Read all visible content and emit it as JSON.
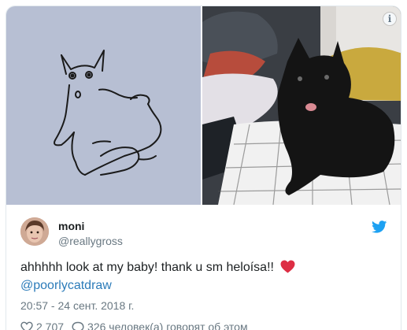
{
  "tweet": {
    "author_name": "moni",
    "author_handle": "@reallygross",
    "text": "ahhhhh look at my baby! thank u sm heloísa!!",
    "mention": "@poorlycatdraw",
    "timestamp": "20:57 - 24 сент. 2018 г.",
    "likes_count": "2 707",
    "replies_text": "326 человек(а) говорят об этом"
  },
  "media": {
    "info_label": "i"
  },
  "icons": {
    "info": "info-icon",
    "bird": "twitter-bird-icon",
    "heart_emoji": "red-heart-emoji",
    "like": "heart-outline-icon",
    "reply": "speech-bubble-icon"
  },
  "colors": {
    "brand_blue": "#1da1f2",
    "link": "#2b7bb9",
    "muted": "#697882",
    "heart": "#dd2e44",
    "drawing_bg": "#b7bfd3"
  }
}
